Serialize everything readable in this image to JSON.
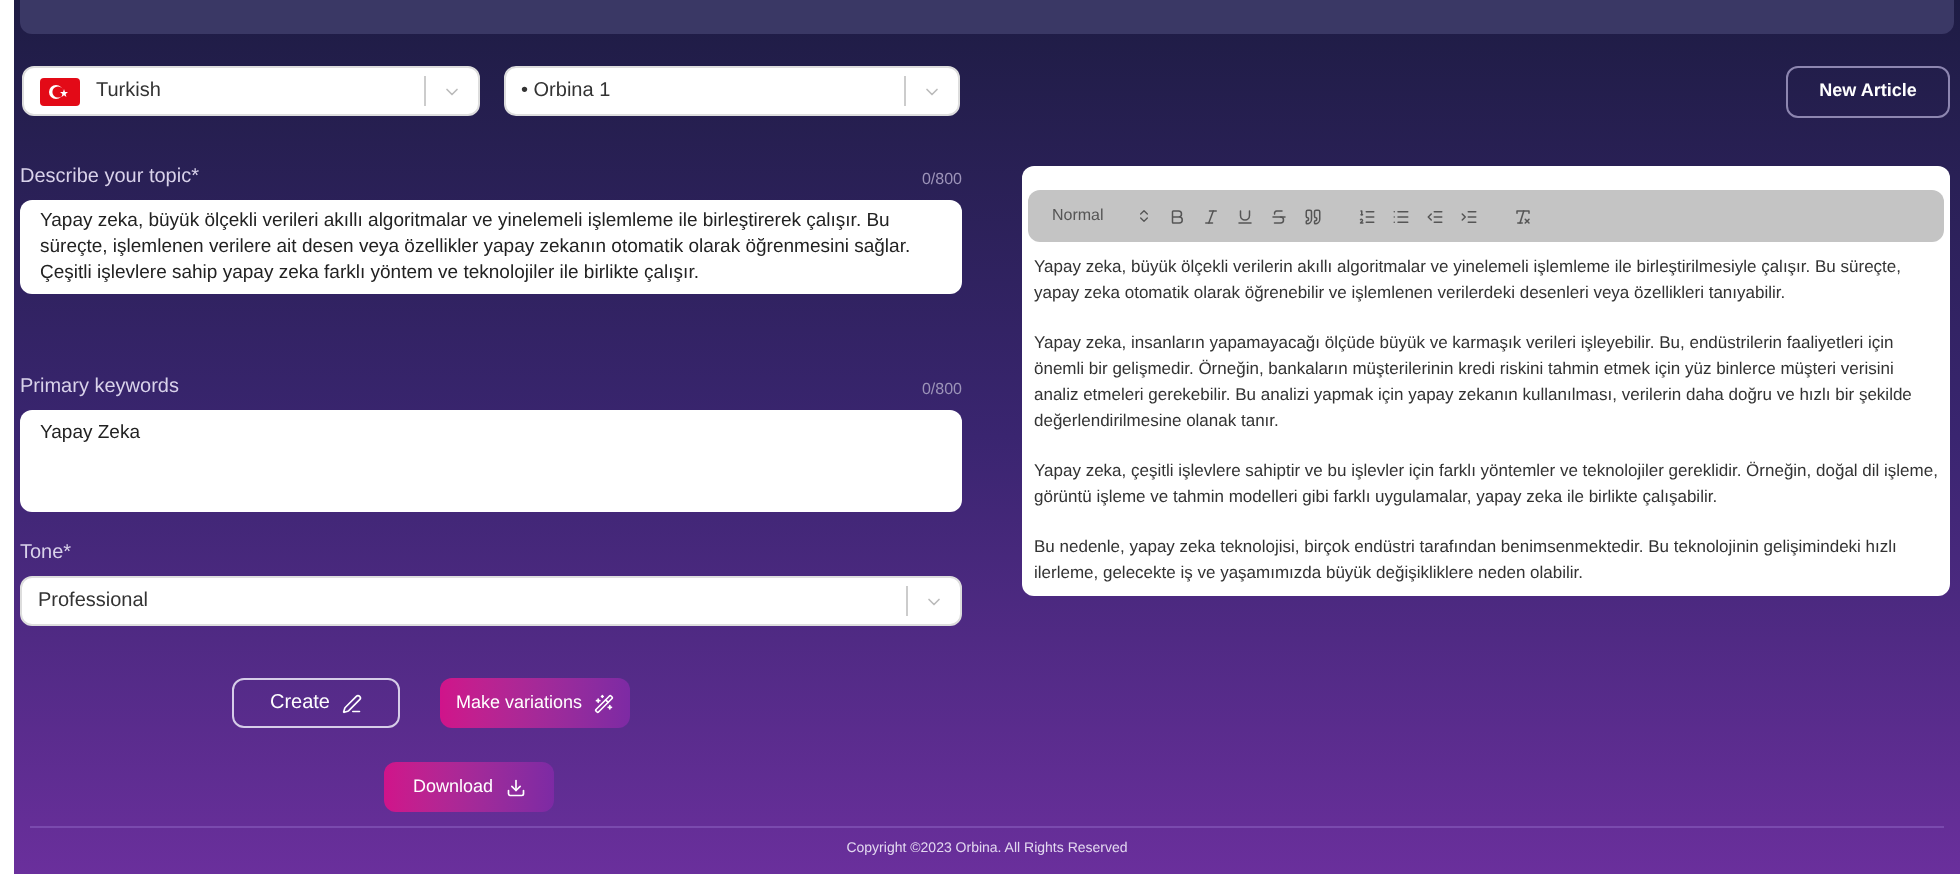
{
  "language_select": {
    "value": "Turkish"
  },
  "model_select": {
    "value": "• Orbina 1"
  },
  "new_article_button": "New Article",
  "topic": {
    "label": "Describe your topic*",
    "counter": "0/800",
    "value": "Yapay zeka, büyük ölçekli verileri akıllı algoritmalar ve yinelemeli işlemleme ile birleştirerek çalışır. Bu süreçte, işlemlenen verilere ait desen veya özellikler yapay zekanın otomatik olarak öğrenmesini sağlar. Çeşitli işlevlere sahip yapay zeka farklı yöntem ve teknolojiler ile birlikte çalışır."
  },
  "keywords": {
    "label": "Primary keywords",
    "counter": "0/800",
    "value": "Yapay Zeka"
  },
  "tone": {
    "label": "Tone*",
    "value": "Professional"
  },
  "buttons": [
    {
      "kind": "outline",
      "label": "Create"
    },
    {
      "kind": "gradient",
      "label": "Make variations"
    }
  ],
  "download_button": "Download",
  "editor": {
    "format": "Normal",
    "paragraphs": [
      "Yapay zeka, büyük ölçekli verilerin akıllı algoritmalar ve yinelemeli işlemleme ile birleştirilmesiyle çalışır. Bu süreçte, yapay zeka otomatik olarak öğrenebilir ve işlemlenen verilerdeki desenleri veya özellikleri tanıyabilir.",
      "Yapay zeka, insanların yapamayacağı ölçüde büyük ve karmaşık verileri işleyebilir. Bu, endüstrilerin faaliyetleri için önemli bir gelişmedir. Örneğin, bankaların müşterilerinin kredi riskini tahmin etmek için yüz binlerce müşteri verisini analiz etmeleri gerekebilir. Bu analizi yapmak için yapay zekanın kullanılması, verilerin daha doğru ve hızlı bir şekilde değerlendirilmesine olanak tanır.",
      "Yapay zeka, çeşitli işlevlere sahiptir ve bu işlevler için farklı yöntemler ve teknolojiler gereklidir. Örneğin, doğal dil işleme, görüntü işleme ve tahmin modelleri gibi farklı uygulamalar, yapay zeka ile birlikte çalışabilir.",
      "Bu nedenle, yapay zeka teknolojisi, birçok endüstri tarafından benimsenmektedir. Bu teknolojinin gelişimindeki hızlı ilerleme, gelecekte iş ve yaşamımızda büyük değişikliklere neden olabilir."
    ]
  },
  "footer": "Copyright ©2023 Orbina. All Rights Reserved"
}
